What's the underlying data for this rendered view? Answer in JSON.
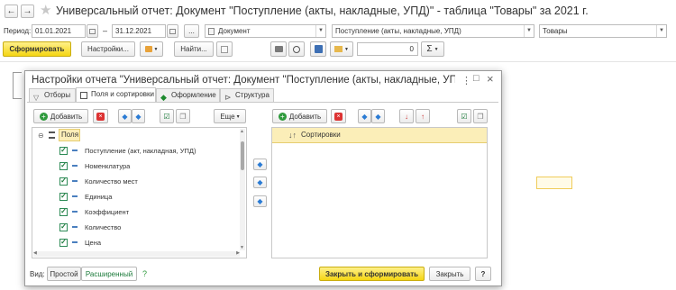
{
  "window": {
    "title": "Универсальный отчет: Документ \"Поступление (акты, накладные, УПД)\" - таблица \"Товары\" за 2021 г."
  },
  "toolbar": {
    "period_label": "Период:",
    "date_from": "01.01.2021",
    "date_to": "31.12.2021",
    "dash": "–",
    "ellipsis": "...",
    "source_type": "Документ",
    "source_object": "Поступление (акты, накладные, УПД)",
    "source_table": "Товары",
    "generate_label": "Сформировать",
    "settings_label": "Настройки...",
    "find_label": "Найти...",
    "sum_value": "0",
    "sigma": "Σ"
  },
  "dialog": {
    "title": "Настройки отчета \"Универсальный отчет: Документ \"Поступление (акты, накладные, УП...",
    "tabs": [
      {
        "label": "Отборы"
      },
      {
        "label": "Поля и сортировки"
      },
      {
        "label": "Оформление"
      },
      {
        "label": "Структура"
      }
    ],
    "fields_panel": {
      "add_label": "Добавить",
      "more_label": "Еще",
      "more_arrow": "▾",
      "header": "Поля",
      "items": [
        {
          "label": "Поступление (акт, накладная, УПД)"
        },
        {
          "label": "Номенклатура"
        },
        {
          "label": "Количество мест"
        },
        {
          "label": "Единица"
        },
        {
          "label": "Коэффициент"
        },
        {
          "label": "Количество"
        },
        {
          "label": "Цена"
        }
      ]
    },
    "sort_panel": {
      "add_label": "Добавить",
      "header": "Сортировки"
    },
    "footer": {
      "view_label": "Вид:",
      "simple_label": "Простой",
      "advanced_label": "Расширенный",
      "help_label": "?",
      "close_generate_label": "Закрыть и сформировать",
      "close_label": "Закрыть",
      "question_label": "?"
    },
    "header_buttons": {
      "menu": "⋮",
      "maximize": "□",
      "close": "×"
    }
  },
  "colors": {
    "accent_yellow": "#f5d613",
    "header_highlight": "#fbeeb8",
    "check_green": "#1b7a3a",
    "arrow_blue": "#2a7bd4"
  }
}
